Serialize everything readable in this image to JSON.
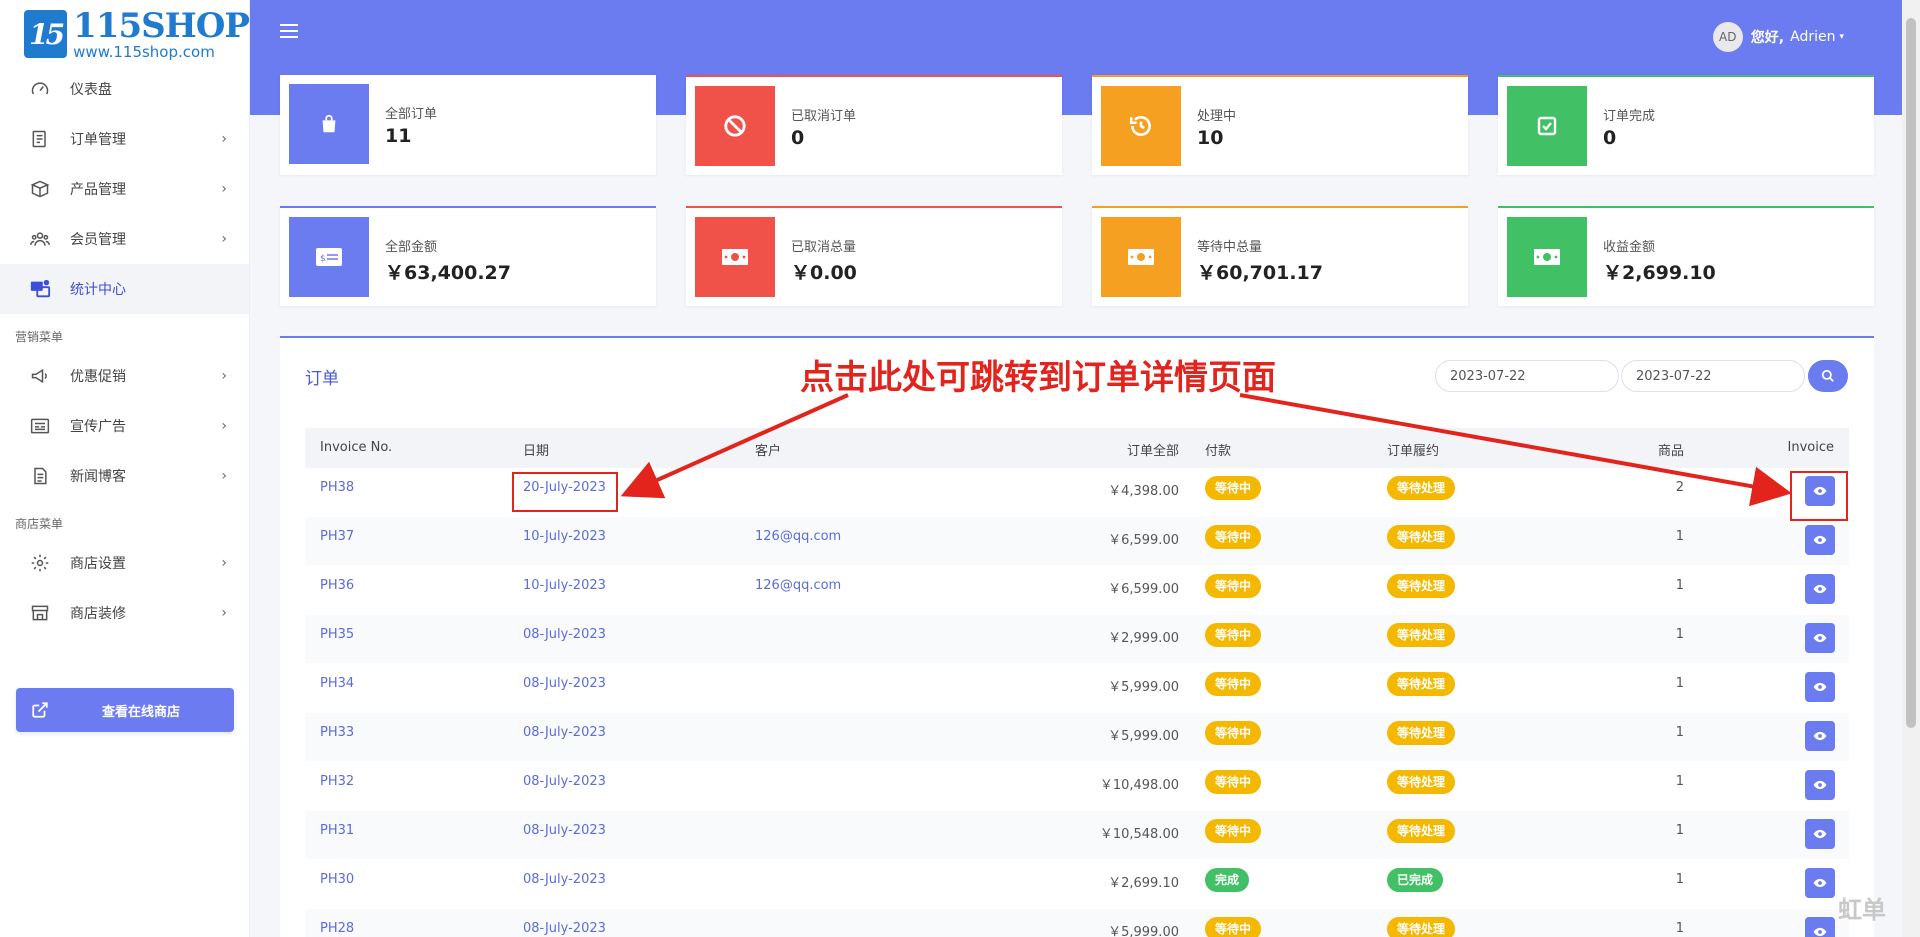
{
  "logo": {
    "mark": "15",
    "title": "115SHOP",
    "url": "www.115shop.com"
  },
  "sidebar": {
    "items": [
      {
        "label": "仪表盘",
        "icon": "dashboard-icon",
        "has_arrow": false,
        "active": false
      },
      {
        "label": "订单管理",
        "icon": "order-icon",
        "has_arrow": true,
        "active": false
      },
      {
        "label": "产品管理",
        "icon": "box-icon",
        "has_arrow": true,
        "active": false
      },
      {
        "label": "会员管理",
        "icon": "users-icon",
        "has_arrow": true,
        "active": false
      },
      {
        "label": "统计中心",
        "icon": "stats-icon",
        "has_arrow": false,
        "active": true
      }
    ],
    "marketing_section": "营销菜单",
    "marketing_items": [
      {
        "label": "优惠促销",
        "icon": "megaphone-icon"
      },
      {
        "label": "宣传广告",
        "icon": "ad-icon"
      },
      {
        "label": "新闻博客",
        "icon": "news-icon"
      }
    ],
    "store_section": "商店菜单",
    "store_items": [
      {
        "label": "商店设置",
        "icon": "gear-icon"
      },
      {
        "label": "商店装修",
        "icon": "store-icon"
      }
    ],
    "store_button": "查看在线商店",
    "arrow": "›"
  },
  "header": {
    "avatar": "AD",
    "greeting": "您好,",
    "username": "Adrien",
    "caret": "▾"
  },
  "stats_row1": [
    {
      "label": "全部订单",
      "value": "11",
      "color": "#6b7bf0",
      "icon": "shopping-bag-icon"
    },
    {
      "label": "已取消订单",
      "value": "0",
      "color": "#f0524a",
      "icon": "ban-icon"
    },
    {
      "label": "处理中",
      "value": "10",
      "color": "#f5a020",
      "icon": "history-icon"
    },
    {
      "label": "订单完成",
      "value": "0",
      "color": "#41c065",
      "icon": "check-square-icon"
    }
  ],
  "stats_row2": [
    {
      "label": "全部金额",
      "value": "￥63,400.27",
      "color": "#6b7bf0",
      "icon": "credit-card-icon"
    },
    {
      "label": "已取消总量",
      "value": "￥0.00",
      "color": "#f0524a",
      "icon": "money-icon"
    },
    {
      "label": "等待中总量",
      "value": "￥60,701.17",
      "color": "#f5a020",
      "icon": "money-icon"
    },
    {
      "label": "收益金额",
      "value": "￥2,699.10",
      "color": "#41c065",
      "icon": "money-icon"
    }
  ],
  "orders": {
    "title": "订单",
    "date_from": "2023-07-22",
    "date_to": "2023-07-22",
    "columns": [
      "Invoice No.",
      "日期",
      "客户",
      "订单全部",
      "付款",
      "订单履约",
      "商品",
      "Invoice"
    ],
    "rows": [
      {
        "invoice": "PH38",
        "date": "20-July-2023",
        "customer": "",
        "amount": "￥4,398.00",
        "payment": "等待中",
        "fulfillment": "等待处理",
        "qty": "2",
        "done": false
      },
      {
        "invoice": "PH37",
        "date": "10-July-2023",
        "customer": "126@qq.com",
        "amount": "￥6,599.00",
        "payment": "等待中",
        "fulfillment": "等待处理",
        "qty": "1",
        "done": false
      },
      {
        "invoice": "PH36",
        "date": "10-July-2023",
        "customer": "126@qq.com",
        "amount": "￥6,599.00",
        "payment": "等待中",
        "fulfillment": "等待处理",
        "qty": "1",
        "done": false
      },
      {
        "invoice": "PH35",
        "date": "08-July-2023",
        "customer": "",
        "amount": "￥2,999.00",
        "payment": "等待中",
        "fulfillment": "等待处理",
        "qty": "1",
        "done": false
      },
      {
        "invoice": "PH34",
        "date": "08-July-2023",
        "customer": "",
        "amount": "￥5,999.00",
        "payment": "等待中",
        "fulfillment": "等待处理",
        "qty": "1",
        "done": false
      },
      {
        "invoice": "PH33",
        "date": "08-July-2023",
        "customer": "",
        "amount": "￥5,999.00",
        "payment": "等待中",
        "fulfillment": "等待处理",
        "qty": "1",
        "done": false
      },
      {
        "invoice": "PH32",
        "date": "08-July-2023",
        "customer": "",
        "amount": "￥10,498.00",
        "payment": "等待中",
        "fulfillment": "等待处理",
        "qty": "1",
        "done": false
      },
      {
        "invoice": "PH31",
        "date": "08-July-2023",
        "customer": "",
        "amount": "￥10,548.00",
        "payment": "等待中",
        "fulfillment": "等待处理",
        "qty": "1",
        "done": false
      },
      {
        "invoice": "PH30",
        "date": "08-July-2023",
        "customer": "",
        "amount": "￥2,699.10",
        "payment": "完成",
        "fulfillment": "已完成",
        "qty": "1",
        "done": true
      },
      {
        "invoice": "PH28",
        "date": "08-July-2023",
        "customer": "",
        "amount": "￥5,999.00",
        "payment": "等待中",
        "fulfillment": "等待处理",
        "qty": "1",
        "done": false
      }
    ]
  },
  "annotation": "点击此处可跳转到订单详情页面",
  "watermark": "虹单"
}
